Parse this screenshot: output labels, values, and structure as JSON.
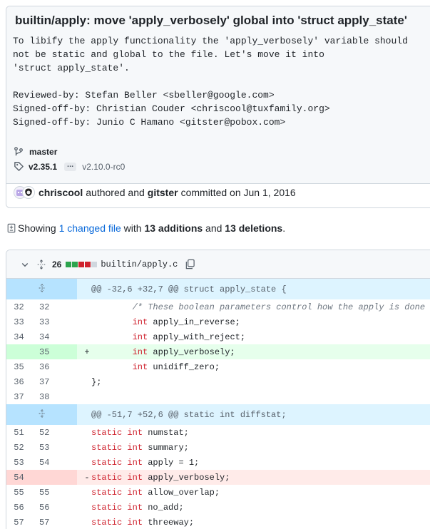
{
  "commit": {
    "title": "builtin/apply: move 'apply_verbosely' global into 'struct apply_state'",
    "body": "To libify the apply functionality the 'apply_verbosely' variable should\nnot be static and global to the file. Let's move it into\n'struct apply_state'.\n\nReviewed-by: Stefan Beller <sbeller@google.com>\nSigned-off-by: Christian Couder <chriscool@tuxfamily.org>\nSigned-off-by: Junio C Hamano <gitster@pobox.com>",
    "branch": "master",
    "tag_main": "v2.35.1",
    "tag_ellipsis": "...",
    "tag_sub": "v2.10.0-rc0",
    "author": "chriscool",
    "authored_text": "authored and",
    "committer": "gitster",
    "committed_text": "committed on Jun 1, 2016"
  },
  "summary": {
    "showing": "Showing",
    "changed_files": "1 changed file",
    "with": "with",
    "additions": "13 additions",
    "and": "and",
    "deletions": "13 deletions",
    "period": "."
  },
  "file": {
    "change_count": "26",
    "diffstat_colors": [
      "#2da44e",
      "#2da44e",
      "#cf222e",
      "#cf222e",
      "#d0d7de"
    ],
    "name": "builtin/apply.c"
  },
  "hunks": [
    {
      "header": "@@ -32,6 +32,7 @@ struct apply_state {"
    },
    {
      "header": "@@ -51,7 +52,6 @@ static int diffstat;"
    }
  ],
  "lines1": [
    {
      "old": "32",
      "new": "32",
      "type": "ctx",
      "parts": [
        {
          "t": "        "
        },
        {
          "t": "/* These boolean parameters control how the apply is done",
          "c": "cm"
        }
      ]
    },
    {
      "old": "33",
      "new": "33",
      "type": "ctx",
      "parts": [
        {
          "t": "        "
        },
        {
          "t": "int",
          "c": "kw"
        },
        {
          "t": " apply_in_reverse;"
        }
      ]
    },
    {
      "old": "34",
      "new": "34",
      "type": "ctx",
      "parts": [
        {
          "t": "        "
        },
        {
          "t": "int",
          "c": "kw"
        },
        {
          "t": " apply_with_reject;"
        }
      ]
    },
    {
      "old": "",
      "new": "35",
      "type": "add",
      "parts": [
        {
          "t": "        "
        },
        {
          "t": "int",
          "c": "kw"
        },
        {
          "t": " apply_verbosely;"
        }
      ]
    },
    {
      "old": "35",
      "new": "36",
      "type": "ctx",
      "parts": [
        {
          "t": "        "
        },
        {
          "t": "int",
          "c": "kw"
        },
        {
          "t": " unidiff_zero;"
        }
      ]
    },
    {
      "old": "36",
      "new": "37",
      "type": "ctx",
      "parts": [
        {
          "t": "};"
        }
      ]
    },
    {
      "old": "37",
      "new": "38",
      "type": "ctx",
      "parts": [
        {
          "t": ""
        }
      ]
    }
  ],
  "lines2": [
    {
      "old": "51",
      "new": "52",
      "type": "ctx",
      "parts": [
        {
          "t": "static",
          "c": "kw"
        },
        {
          "t": " "
        },
        {
          "t": "int",
          "c": "kw"
        },
        {
          "t": " numstat;"
        }
      ]
    },
    {
      "old": "52",
      "new": "53",
      "type": "ctx",
      "parts": [
        {
          "t": "static",
          "c": "kw"
        },
        {
          "t": " "
        },
        {
          "t": "int",
          "c": "kw"
        },
        {
          "t": " summary;"
        }
      ]
    },
    {
      "old": "53",
      "new": "54",
      "type": "ctx",
      "parts": [
        {
          "t": "static",
          "c": "kw"
        },
        {
          "t": " "
        },
        {
          "t": "int",
          "c": "kw"
        },
        {
          "t": " apply = 1;"
        }
      ]
    },
    {
      "old": "54",
      "new": "",
      "type": "del",
      "parts": [
        {
          "t": "static",
          "c": "kw"
        },
        {
          "t": " "
        },
        {
          "t": "int",
          "c": "kw"
        },
        {
          "t": " apply_verbosely;"
        }
      ]
    },
    {
      "old": "55",
      "new": "55",
      "type": "ctx",
      "parts": [
        {
          "t": "static",
          "c": "kw"
        },
        {
          "t": " "
        },
        {
          "t": "int",
          "c": "kw"
        },
        {
          "t": " allow_overlap;"
        }
      ]
    },
    {
      "old": "56",
      "new": "56",
      "type": "ctx",
      "parts": [
        {
          "t": "static",
          "c": "kw"
        },
        {
          "t": " "
        },
        {
          "t": "int",
          "c": "kw"
        },
        {
          "t": " no_add;"
        }
      ]
    },
    {
      "old": "57",
      "new": "57",
      "type": "ctx",
      "parts": [
        {
          "t": "static",
          "c": "kw"
        },
        {
          "t": " "
        },
        {
          "t": "int",
          "c": "kw"
        },
        {
          "t": " threeway;"
        }
      ]
    }
  ],
  "marks": {
    "add": "+",
    "del": "-"
  }
}
